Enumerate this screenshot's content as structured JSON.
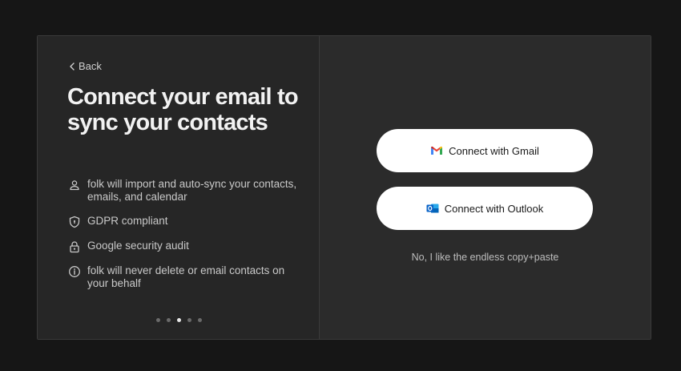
{
  "nav": {
    "back_label": "Back"
  },
  "headline": "Connect your email to sync your contacts",
  "features": [
    {
      "icon": "user-icon",
      "text": "folk will import and auto-sync your contacts, emails, and calendar"
    },
    {
      "icon": "shield-icon",
      "text": "GDPR compliant"
    },
    {
      "icon": "lock-icon",
      "text": "Google security audit"
    },
    {
      "icon": "info-icon",
      "text": "folk will never delete or email contacts on your behalf"
    }
  ],
  "pagination": {
    "total": 5,
    "active_index": 2
  },
  "actions": {
    "gmail_label": "Connect with Gmail",
    "outlook_label": "Connect with Outlook",
    "skip_label": "No, I like the endless copy+paste"
  },
  "colors": {
    "background": "#161616",
    "left_panel": "#262626",
    "right_panel": "#2b2b2b",
    "button": "#ffffff"
  }
}
